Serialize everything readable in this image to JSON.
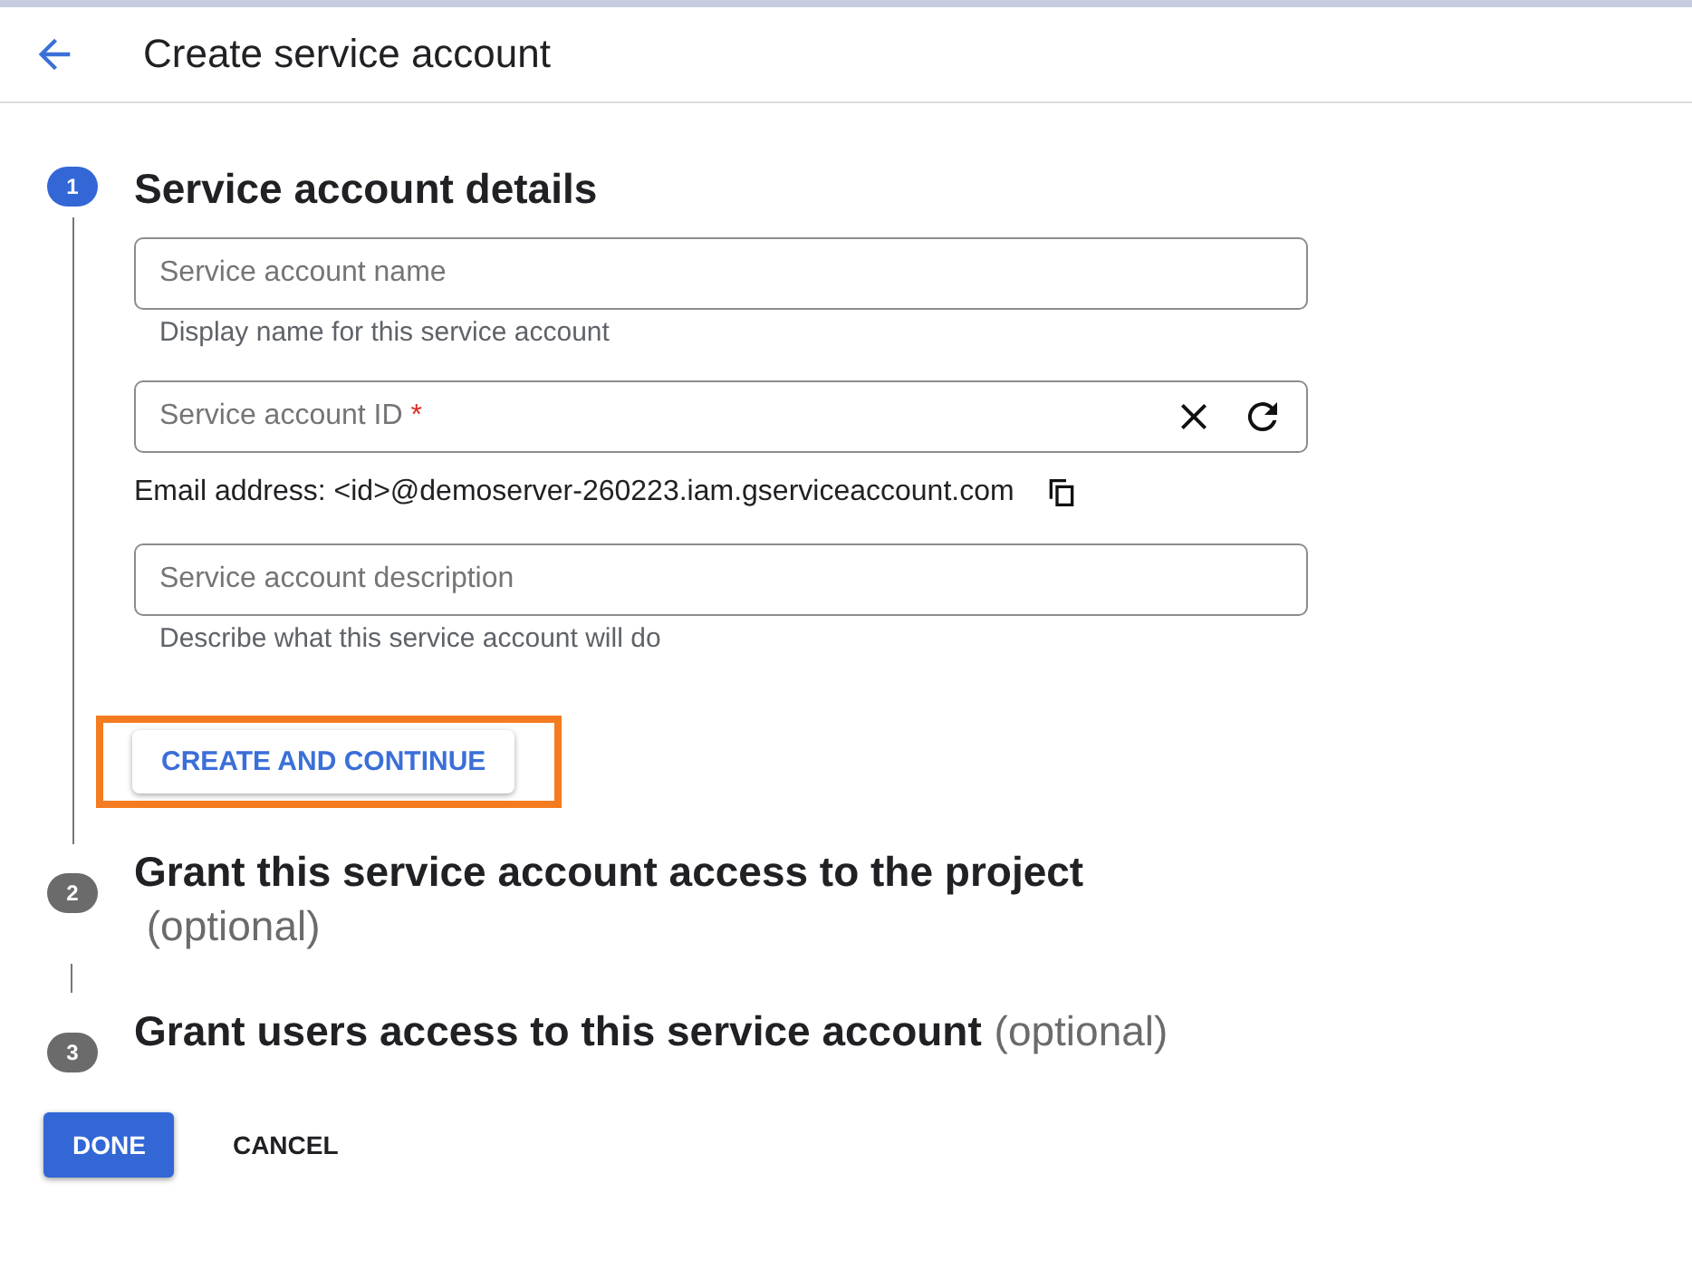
{
  "header": {
    "title": "Create service account"
  },
  "steps": [
    {
      "number": "1",
      "title": "Service account details",
      "selected": true,
      "fields": [
        {
          "placeholder": "Service account name",
          "helper": "Display name for this service account"
        },
        {
          "placeholder": "Service account ID",
          "required_mark": "*",
          "actions": [
            {
              "kind": "clear"
            },
            {
              "kind": "refresh"
            }
          ],
          "email": "Email address: <id>@demoserver-260223.iam.gserviceaccount.com"
        },
        {
          "placeholder": "Service account description",
          "helper": "Describe what this service account will do"
        }
      ],
      "button": {
        "label": "CREATE AND CONTINUE",
        "highlighted": true
      }
    },
    {
      "number": "2",
      "title": "Grant this service account access to the project",
      "optional": "(optional)",
      "selected": false
    },
    {
      "number": "3",
      "title": "Grant users access to this service account",
      "optional": "(optional)",
      "selected": false
    }
  ],
  "buttons": [
    {
      "label": "DONE",
      "kind": "primary"
    },
    {
      "label": "CANCEL",
      "kind": "text"
    }
  ]
}
